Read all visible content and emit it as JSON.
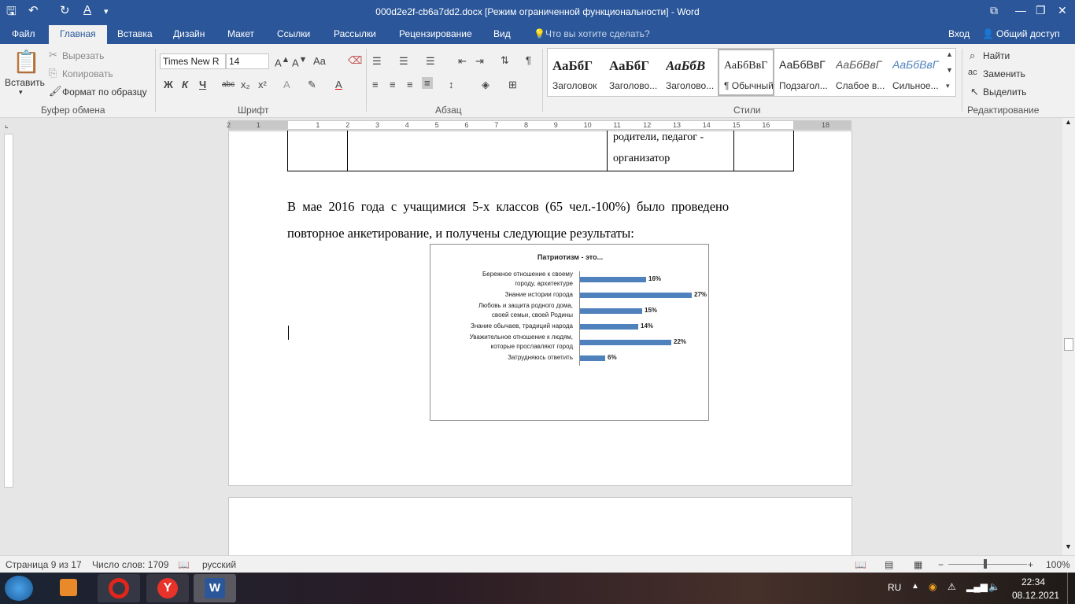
{
  "titlebar": {
    "title": "000d2e2f-cb6a7dd2.docx [Режим ограниченной функциональности] - Word"
  },
  "tabs": {
    "file": "Файл",
    "home": "Главная",
    "insert": "Вставка",
    "design": "Дизайн",
    "layout": "Макет",
    "references": "Ссылки",
    "mailings": "Рассылки",
    "review": "Рецензирование",
    "view": "Вид",
    "tell_me": "Что вы хотите сделать?",
    "signin": "Вход",
    "share": "Общий доступ"
  },
  "clipboard": {
    "paste": "Вставить",
    "cut": "Вырезать",
    "copy": "Копировать",
    "format_painter": "Формат по образцу",
    "label": "Буфер обмена"
  },
  "font": {
    "name": "Times New R",
    "size": "14",
    "case": "Aa",
    "bold": "Ж",
    "italic": "К",
    "underline": "Ч",
    "strike": "abc",
    "label": "Шрифт"
  },
  "paragraph": {
    "label": "Абзац"
  },
  "styles": {
    "label": "Стили",
    "items": [
      {
        "preview": "АаБбГ",
        "name": "Заголовок"
      },
      {
        "preview": "АаБбГ",
        "name": "Заголово..."
      },
      {
        "preview": "АаБбВ",
        "name": "Заголово..."
      },
      {
        "preview": "АаБбВвГ",
        "name": "¶ Обычный"
      },
      {
        "preview": "АаБбВвГ",
        "name": "Подзагол..."
      },
      {
        "preview": "АаБбВвГ",
        "name": "Слабое в..."
      },
      {
        "preview": "АаБбВвГ",
        "name": "Сильное..."
      }
    ]
  },
  "editing": {
    "find": "Найти",
    "replace": "Заменить",
    "select": "Выделить",
    "label": "Редактирование"
  },
  "document": {
    "table_text_line1": "родители,  педагог -",
    "table_text_line2": "организатор",
    "para_line1": "В  мае  2016  года  с  учащимися  5-х  классов  (65  чел.-100%)  было  проведено",
    "para_line2": "повторное анкетирование, и получены следующие результаты:"
  },
  "chart_data": {
    "type": "bar",
    "title": "Патриотизм - это...",
    "categories": [
      "Бережное отношение к своему городу, архитектуре",
      "Знание истории города",
      "Любовь и защита  родного дома, своей семьи, своей Родины",
      "Знание обычаев, традиций народа",
      "Уважительное отношение к людям, которые прославляют город",
      "Затрудняюсь ответить"
    ],
    "category_lines": [
      [
        "Бережное отношение к своему",
        "городу, архитектуре"
      ],
      [
        "Знание истории города"
      ],
      [
        "Любовь и защита  родного дома,",
        "своей семьи, своей Родины"
      ],
      [
        "Знание обычаев, традиций народа"
      ],
      [
        "Уважительное отношение к людям,",
        "которые прославляют город"
      ],
      [
        "Затрудняюсь ответить"
      ]
    ],
    "values": [
      16,
      27,
      15,
      14,
      22,
      6
    ],
    "value_labels": [
      "16%",
      "27%",
      "15%",
      "14%",
      "22%",
      "6%"
    ],
    "orientation": "horizontal",
    "bar_color": "#4f81bd",
    "grid": false
  },
  "status": {
    "page": "Страница 9 из 17",
    "words": "Число слов: 1709",
    "lang": "русский",
    "zoom": "100%"
  },
  "taskbar": {
    "lang": "RU",
    "time": "22:34",
    "date": "08.12.2021"
  },
  "colors": {
    "word_blue": "#2b579a",
    "bar": "#4f81bd"
  }
}
